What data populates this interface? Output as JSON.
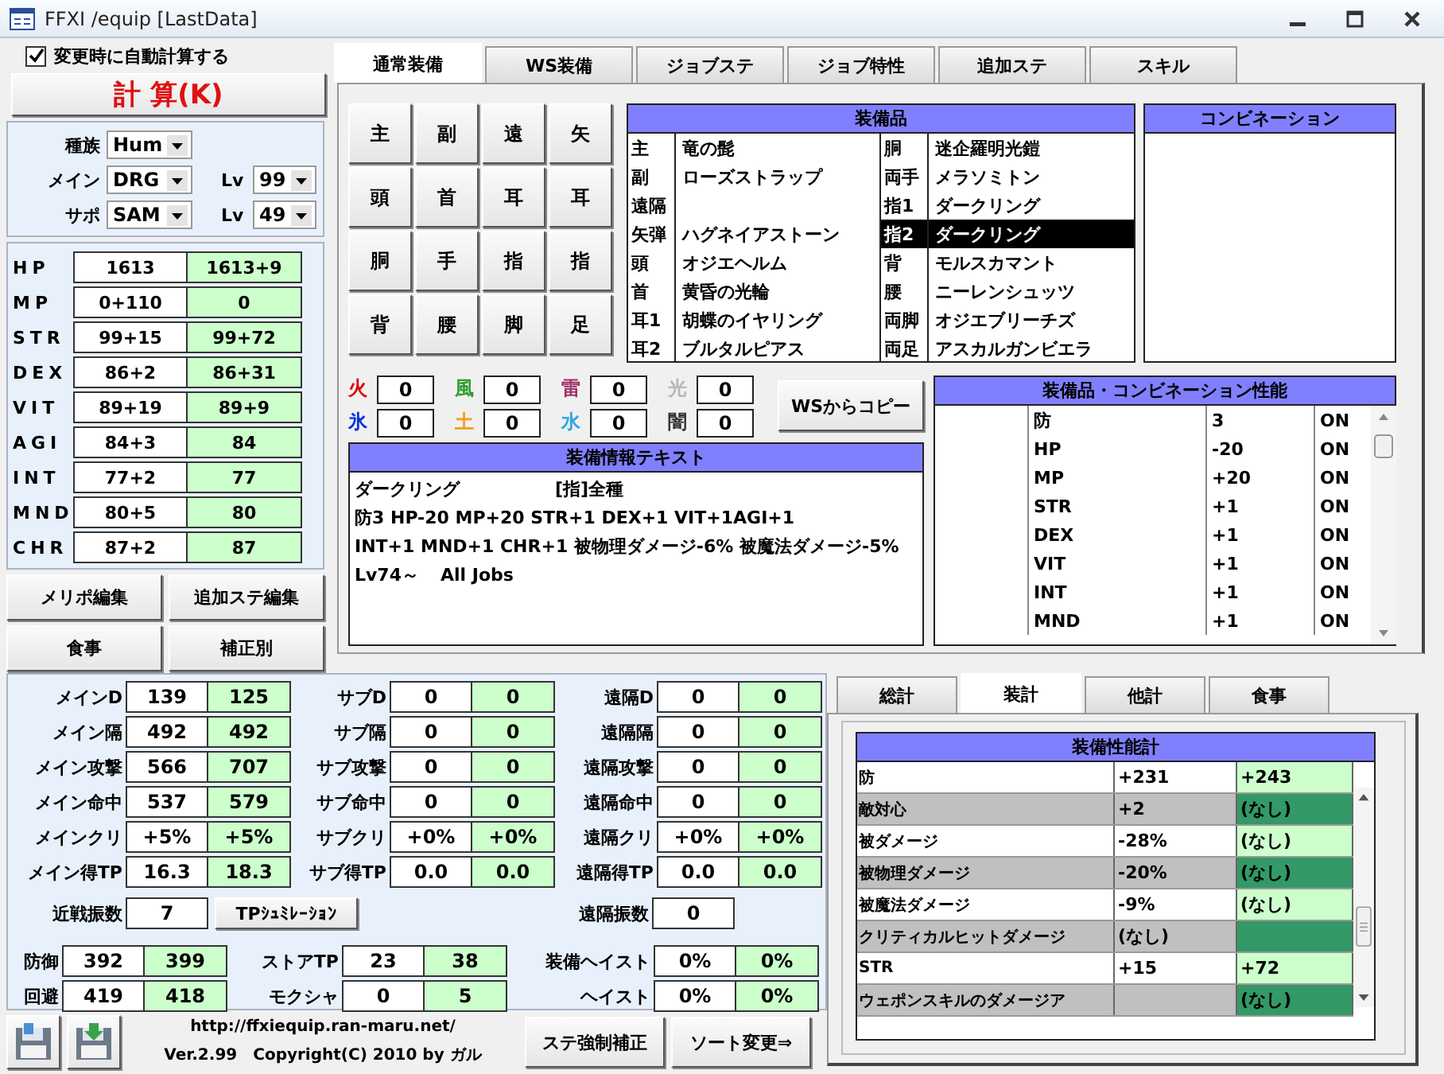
{
  "window": {
    "title": "FFXI /equip [LastData]"
  },
  "auto_calc": {
    "label": "変更時に自動計算する",
    "checked": true
  },
  "calc_button": "計 算(K)",
  "character": [
    {
      "label": "種族",
      "value": "Hum"
    },
    {
      "label": "メイン",
      "value": "DRG",
      "lv_label": "Lv",
      "lv": "99"
    },
    {
      "label": "サポ",
      "value": "SAM",
      "lv_label": "Lv",
      "lv": "49"
    }
  ],
  "stats": [
    {
      "name": "HP",
      "base": "1613",
      "total": "1613+9"
    },
    {
      "name": "MP",
      "base": "0+110",
      "total": "0"
    },
    {
      "name": "STR",
      "base": "99+15",
      "total": "99+72"
    },
    {
      "name": "DEX",
      "base": "86+2",
      "total": "86+31"
    },
    {
      "name": "VIT",
      "base": "89+19",
      "total": "89+9"
    },
    {
      "name": "AGI",
      "base": "84+3",
      "total": "84"
    },
    {
      "name": "INT",
      "base": "77+2",
      "total": "77"
    },
    {
      "name": "MND",
      "base": "80+5",
      "total": "80"
    },
    {
      "name": "CHR",
      "base": "87+2",
      "total": "87"
    }
  ],
  "left_buttons": [
    "メリポ編集",
    "追加ステ編集",
    "食事",
    "補正別"
  ],
  "tabs": [
    {
      "label": "通常装備",
      "selected": true
    },
    {
      "label": "WS装備",
      "selected": false
    },
    {
      "label": "ジョブステ",
      "selected": false
    },
    {
      "label": "ジョブ特性",
      "selected": false
    },
    {
      "label": "追加ステ",
      "selected": false
    },
    {
      "label": "スキル",
      "selected": false
    }
  ],
  "slot_buttons": [
    "主",
    "副",
    "遠",
    "矢",
    "頭",
    "首",
    "耳",
    "耳",
    "胴",
    "手",
    "指",
    "指",
    "背",
    "腰",
    "脚",
    "足"
  ],
  "equipment": {
    "title": "装備品",
    "items": [
      {
        "slot": "主",
        "item": "竜の髭",
        "selected": false
      },
      {
        "slot": "副",
        "item": "ローズストラップ",
        "selected": false
      },
      {
        "slot": "遠隔",
        "selected": false
      },
      {
        "slot": "矢弾",
        "item": "ハグネイアストーン",
        "selected": false
      },
      {
        "slot": "頭",
        "item": "オジエヘルム",
        "selected": false
      },
      {
        "slot": "首",
        "item": "黄昏の光輪",
        "selected": false
      },
      {
        "slot": "耳1",
        "item": "胡蝶のイヤリング",
        "selected": false
      },
      {
        "slot": "耳2",
        "item": "ブルタルピアス",
        "selected": false
      },
      {
        "slot": "胴",
        "item": "迷企羅明光鎧",
        "selected": false
      },
      {
        "slot": "両手",
        "item": "メラソミトン",
        "selected": false
      },
      {
        "slot": "指1",
        "item": "ダークリング",
        "selected": false
      },
      {
        "slot": "指2",
        "item": "ダークリング",
        "selected": true
      },
      {
        "slot": "背",
        "item": "モルスカマント",
        "selected": false
      },
      {
        "slot": "腰",
        "item": "ニーレンシュッツ",
        "selected": false
      },
      {
        "slot": "両脚",
        "item": "オジエブリーチズ",
        "selected": false
      },
      {
        "slot": "両足",
        "item": "アスカルガンビエラ",
        "selected": false
      }
    ]
  },
  "combination": {
    "title": "コンビネーション"
  },
  "elements": [
    {
      "label": "火",
      "value": "0",
      "color": "#e00000"
    },
    {
      "label": "風",
      "value": "0",
      "color": "#2e9c2e"
    },
    {
      "label": "雷",
      "value": "0",
      "color": "#a0306a"
    },
    {
      "label": "光",
      "value": "0",
      "color": "#b8b8b8"
    },
    {
      "label": "氷",
      "value": "0",
      "color": "#0030e0"
    },
    {
      "label": "土",
      "value": "0",
      "color": "#f0a020"
    },
    {
      "label": "水",
      "value": "0",
      "color": "#30a8e0"
    },
    {
      "label": "闇",
      "value": "0",
      "color": "#333333"
    }
  ],
  "ws_copy_button": "WSからコピー",
  "equip_info": {
    "title": "装備情報テキスト",
    "name": "ダークリング",
    "slot_type": "[指]全種",
    "lines": [
      "防3 HP-20 MP+20 STR+1 DEX+1 VIT+1AGI+1",
      "INT+1 MND+1 CHR+1 被物理ダメージ-6% 被魔法ダメージ-5%"
    ],
    "level": "Lv74～",
    "jobs": "All Jobs"
  },
  "performance": {
    "title": "装備品・コンビネーション性能",
    "rows": [
      {
        "name": "防",
        "value": "3",
        "state": "ON"
      },
      {
        "name": "HP",
        "value": "-20",
        "state": "ON"
      },
      {
        "name": "MP",
        "value": "+20",
        "state": "ON"
      },
      {
        "name": "STR",
        "value": "+1",
        "state": "ON"
      },
      {
        "name": "DEX",
        "value": "+1",
        "state": "ON"
      },
      {
        "name": "VIT",
        "value": "+1",
        "state": "ON"
      },
      {
        "name": "INT",
        "value": "+1",
        "state": "ON"
      },
      {
        "name": "MND",
        "value": "+1",
        "state": "ON"
      }
    ]
  },
  "attack_stats": {
    "main": [
      {
        "label": "メインD",
        "base": "139",
        "total": "125"
      },
      {
        "label": "メイン隔",
        "base": "492",
        "total": "492"
      },
      {
        "label": "メイン攻撃",
        "base": "566",
        "total": "707"
      },
      {
        "label": "メイン命中",
        "base": "537",
        "total": "579"
      },
      {
        "label": "メインクリ",
        "base": "+5%",
        "total": "+5%"
      },
      {
        "label": "メイン得TP",
        "base": "16.3",
        "total": "18.3"
      }
    ],
    "sub": [
      {
        "label": "サブD",
        "base": "0",
        "total": "0"
      },
      {
        "label": "サブ隔",
        "base": "0",
        "total": "0"
      },
      {
        "label": "サブ攻撃",
        "base": "0",
        "total": "0"
      },
      {
        "label": "サブ命中",
        "base": "0",
        "total": "0"
      },
      {
        "label": "サブクリ",
        "base": "+0%",
        "total": "+0%"
      },
      {
        "label": "サブ得TP",
        "base": "0.0",
        "total": "0.0"
      }
    ],
    "ranged": [
      {
        "label": "遠隔D",
        "base": "0",
        "total": "0"
      },
      {
        "label": "遠隔隔",
        "base": "0",
        "total": "0"
      },
      {
        "label": "遠隔攻撃",
        "base": "0",
        "total": "0"
      },
      {
        "label": "遠隔命中",
        "base": "0",
        "total": "0"
      },
      {
        "label": "遠隔クリ",
        "base": "+0%",
        "total": "+0%"
      },
      {
        "label": "遠隔得TP",
        "base": "0.0",
        "total": "0.0"
      }
    ]
  },
  "swings": {
    "melee": {
      "label": "近戦振数",
      "value": "7"
    },
    "tp_sim_button": "TPｼｭﾐﾚｰｼｮﾝ",
    "ranged": {
      "label": "遠隔振数",
      "value": "0"
    }
  },
  "defense": [
    {
      "label": "防御",
      "base": "392",
      "total": "399"
    },
    {
      "label": "回避",
      "base": "419",
      "total": "418"
    }
  ],
  "tp": [
    {
      "label": "ストアTP",
      "base": "23",
      "total": "38"
    },
    {
      "label": "モクシャ",
      "base": "0",
      "total": "5"
    }
  ],
  "haste": [
    {
      "label": "装備ヘイスト",
      "base": "0%",
      "total": "0%"
    },
    {
      "label": "ヘイスト",
      "base": "0%",
      "total": "0%"
    }
  ],
  "footer": {
    "url": "http://ffxiequip.ran-maru.net/",
    "version": "Ver.2.99　Copyright(C) 2010 by ガル",
    "buttons": [
      "ステ強制補正",
      "ソート変更⇒"
    ]
  },
  "summary_tabs": [
    {
      "label": "総計",
      "selected": false
    },
    {
      "label": "装計",
      "selected": true
    },
    {
      "label": "他計",
      "selected": false
    },
    {
      "label": "食事",
      "selected": false
    }
  ],
  "summary_table": {
    "title": "装備性能計",
    "rows": [
      {
        "name": "防",
        "value": "+231",
        "total": "+243"
      },
      {
        "name": "敵対心",
        "value": "+2",
        "total": "(なし)"
      },
      {
        "name": "被ダメージ",
        "value": "-28%",
        "total": "(なし)"
      },
      {
        "name": "被物理ダメージ",
        "value": "-20%",
        "total": "(なし)"
      },
      {
        "name": "被魔法ダメージ",
        "value": "-9%",
        "total": "(なし)"
      },
      {
        "name": "クリティカルヒットダメージ",
        "value": "(なし)"
      },
      {
        "name": "STR",
        "value": "+15",
        "total": "+72"
      },
      {
        "name": "ウェポンスキルのダメージア",
        "total": "(なし)"
      }
    ]
  }
}
